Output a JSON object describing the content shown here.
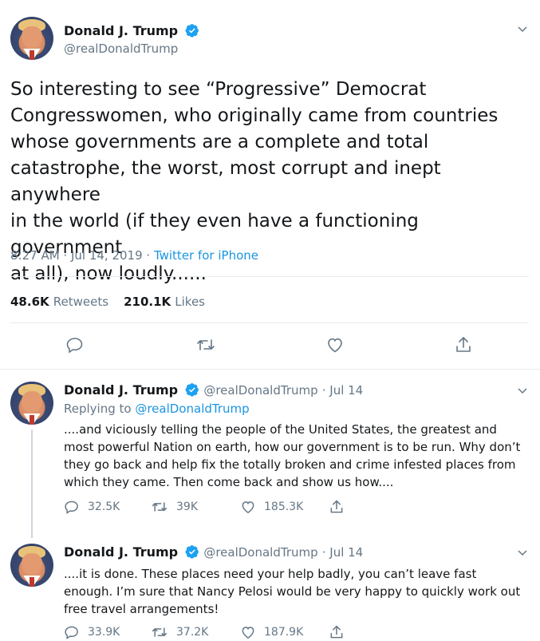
{
  "main_tweet": {
    "author_name": "Donald J. Trump",
    "author_handle": "@realDonaldTrump",
    "text": "So interesting to see “Progressive” Democrat\nCongresswomen, who originally came from countries\nwhose governments are a complete and total\ncatastrophe, the worst, most corrupt and inept anywhere\nin the world (if they even have a functioning government\nat all), now loudly......",
    "time": "8:27 AM · Jul 14, 2019 · ",
    "source": "Twitter for iPhone",
    "retweets_count": "48.6K",
    "retweets_label": "Retweets",
    "likes_count": "210.1K",
    "likes_label": "Likes"
  },
  "replies": [
    {
      "author_name": "Donald J. Trump",
      "author_handle": "@realDonaldTrump",
      "date": "· Jul 14",
      "replying_label": "Replying to ",
      "replying_handle": "@realDonaldTrump",
      "text": "....and viciously telling the people of the United States, the greatest and most powerful Nation on earth, how our government is to be run. Why don’t they go back and help fix the totally broken and crime infested places from which they came. Then come back and show us how....",
      "reply_count": "32.5K",
      "retweet_count": "39K",
      "like_count": "185.3K"
    },
    {
      "author_name": "Donald J. Trump",
      "author_handle": "@realDonaldTrump",
      "date": "· Jul 14",
      "text": "....it is done. These places need your help badly, you can’t leave fast enough. I’m sure that Nancy Pelosi would be very happy to quickly work out free travel arrangements!",
      "reply_count": "33.9K",
      "retweet_count": "37.2K",
      "like_count": "187.9K"
    }
  ],
  "colors": {
    "text": "#14171a",
    "secondary": "#657786",
    "link": "#1b95e0",
    "verified": "#1da1f2",
    "divider": "#e6ecf0"
  }
}
